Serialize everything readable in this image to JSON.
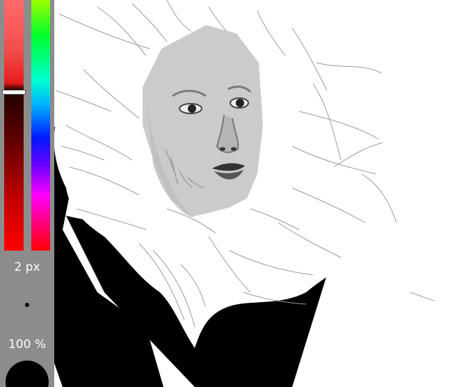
{
  "app": {
    "title": ""
  },
  "sidebar": {
    "brush_size_label": "2 px",
    "opacity_label": "100 %",
    "lightness_slider": {
      "value_fraction": 0.37
    },
    "hue_slider": {
      "selected_color": "#ff0000"
    },
    "brush_preview_color": "#000000"
  },
  "canvas": {
    "background": "#ffffff",
    "subject": "sketch-portrait"
  }
}
